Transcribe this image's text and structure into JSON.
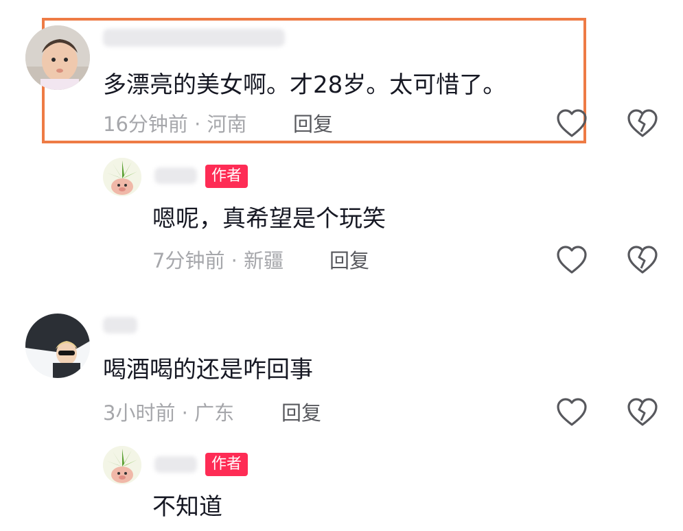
{
  "comments": [
    {
      "text": "多漂亮的美女啊。才28岁。太可惜了。",
      "meta": "16分钟前 · 河南",
      "reply_label": "回复",
      "icons": [
        "like-heart-icon",
        "dislike-broken-heart-icon"
      ],
      "avatar": "baby-avatar"
    },
    {
      "badge": "作者",
      "text": "嗯呢，真希望是个玩笑",
      "meta": "7分钟前 · 新疆",
      "reply_label": "回复",
      "icons": [
        "like-heart-icon",
        "dislike-broken-heart-icon"
      ],
      "avatar": "plant-avatar"
    },
    {
      "text": "喝酒喝的还是咋回事",
      "meta": "3小时前 · 广东",
      "reply_label": "回复",
      "icons": [
        "like-heart-icon",
        "dislike-broken-heart-icon"
      ],
      "avatar": "boy-avatar"
    },
    {
      "badge": "作者",
      "text": "不知道",
      "avatar": "plant-avatar"
    }
  ],
  "colors": {
    "highlight": "#ee7b45",
    "author_badge": "#fe2c55",
    "meta_text": "#a6a7ab",
    "reply_text": "#57585d"
  }
}
